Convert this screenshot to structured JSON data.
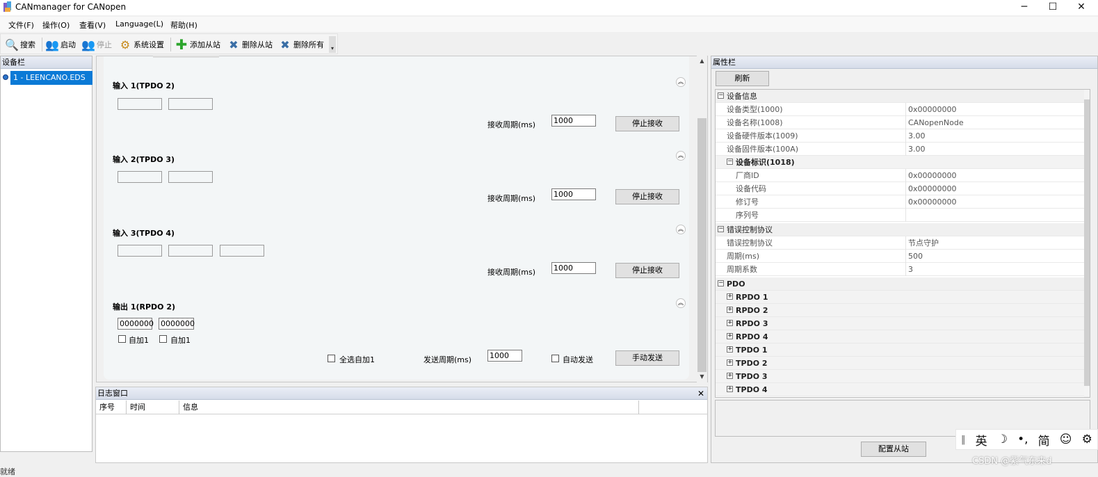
{
  "window": {
    "title": "CANmanager for CANopen",
    "min": "─",
    "max": "☐",
    "close": "✕"
  },
  "menu": [
    "文件(F)",
    "操作(O)",
    "查看(V)",
    "Language(L)",
    "帮助(H)"
  ],
  "toolbar": {
    "search": "搜索",
    "start": "启动",
    "stop": "停止",
    "settings": "系统设置",
    "add": "添加从站",
    "remove": "删除从站",
    "remove_all": "删除所有"
  },
  "device_panel": {
    "title": "设备栏",
    "node": "1 - LEENCANO.EDS"
  },
  "status": "就绪",
  "config": {
    "recv_label": "接收周期(ms)",
    "stop_label": "停止接收",
    "inputs": [
      {
        "title": "输入 1(TPDO 2)",
        "period": "1000"
      },
      {
        "title": "输入 2(TPDO 3)",
        "period": "1000"
      },
      {
        "title": "输入 3(TPDO 4)",
        "period": "1000"
      }
    ],
    "output": {
      "title": "输出 1(RPDO 2)",
      "values": [
        "0000000",
        "0000000"
      ],
      "auto_inc": "自加1",
      "select_all": "全选自加1",
      "send_label": "发送周期(ms)",
      "period": "1000",
      "auto_send": "自动发送",
      "manual_send": "手动发送"
    }
  },
  "log": {
    "title": "日志窗口",
    "close": "✕",
    "columns": [
      "序号",
      "时间",
      "信息"
    ]
  },
  "props": {
    "title": "属性栏",
    "refresh": "刷新",
    "device_info": "设备信息",
    "device_rows": [
      {
        "name": "设备类型(1000)",
        "value": "0x00000000"
      },
      {
        "name": "设备名称(1008)",
        "value": "CANopenNode"
      },
      {
        "name": "设备硬件版本(1009)",
        "value": "3.00"
      },
      {
        "name": "设备固件版本(100A)",
        "value": "3.00"
      }
    ],
    "identity": "设备标识(1018)",
    "identity_rows": [
      {
        "name": "厂商ID",
        "value": "0x00000000"
      },
      {
        "name": "设备代码",
        "value": "0x00000000"
      },
      {
        "name": "修订号",
        "value": "0x00000000"
      },
      {
        "name": "序列号",
        "value": ""
      }
    ],
    "err_cat": "错误控制协议",
    "err_rows": [
      {
        "name": "错误控制协议",
        "value": "节点守护"
      },
      {
        "name": "周期(ms)",
        "value": "500"
      },
      {
        "name": "周期系数",
        "value": "3"
      }
    ],
    "pdo_cat": "PDO",
    "pdo_items": [
      "RPDO 1",
      "RPDO 2",
      "RPDO 3",
      "RPDO 4",
      "TPDO 1",
      "TPDO 2",
      "TPDO 3",
      "TPDO 4"
    ],
    "config_button": "配置从站"
  },
  "ime": {
    "lang": "英",
    "simp": "简"
  },
  "watermark": "CSDN @紫气东来d"
}
